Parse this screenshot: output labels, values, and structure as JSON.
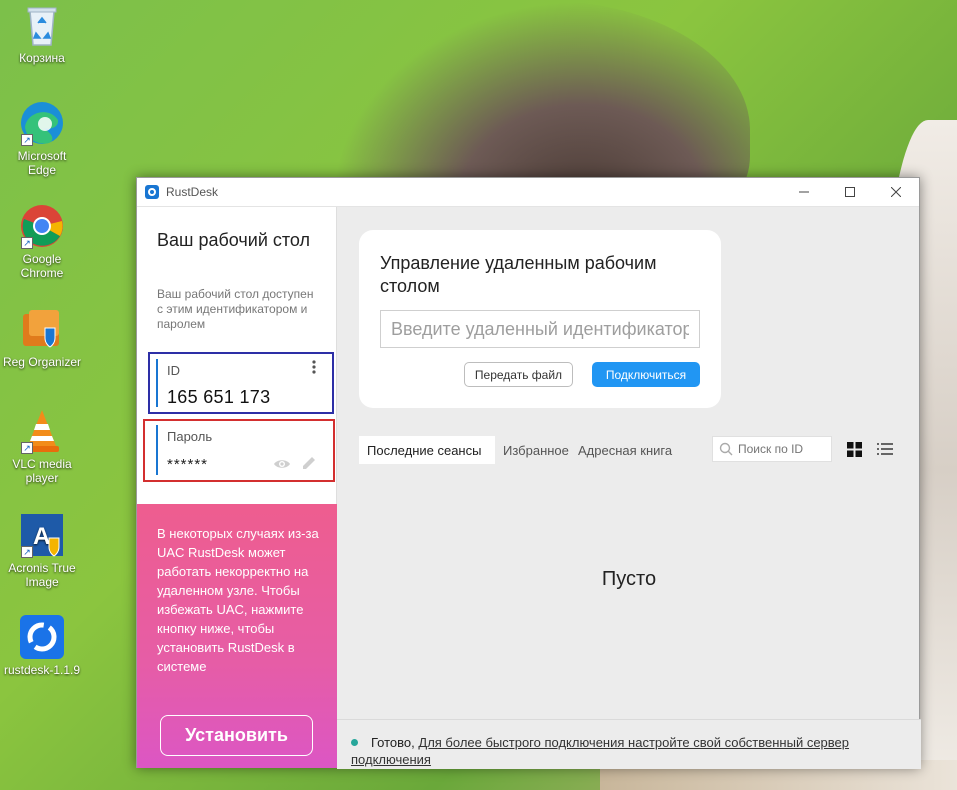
{
  "desktop": {
    "icons": [
      {
        "label": "Корзина"
      },
      {
        "label": "Microsoft Edge"
      },
      {
        "label": "Google Chrome"
      },
      {
        "label": "Reg Organizer"
      },
      {
        "label": "VLC media player"
      },
      {
        "label": "Acronis True Image"
      },
      {
        "label": "rustdesk-1.1.9"
      }
    ]
  },
  "window": {
    "title": "RustDesk",
    "controls": {
      "minimize": "—",
      "maximize": "☐",
      "close": "✕"
    }
  },
  "left": {
    "title": "Ваш рабочий стол",
    "description": "Ваш рабочий стол доступен с этим идентификатором и паролем",
    "id_label": "ID",
    "id_value": "165 651 173",
    "password_label": "Пароль",
    "password_value": "******",
    "install_text": "В некоторых случаях из-за UAC RustDesk может работать некорректно на удаленном узле. Чтобы избежать UAC, нажмите кнопку ниже, чтобы установить RustDesk в системе",
    "install_button": "Установить"
  },
  "main": {
    "card_title": "Управление удаленным рабочим столом",
    "remote_placeholder": "Введите удаленный идентификатор",
    "file_button": "Передать файл",
    "connect_button": "Подключиться",
    "tabs": [
      "Последние сеансы",
      "Избранное",
      "Адресная книга"
    ],
    "search_placeholder": "Поиск по ID",
    "empty_text": "Пусто"
  },
  "status": {
    "ready": "Готово,",
    "link": "Для более быстрого подключения настройте свой собственный сервер подключения"
  },
  "colors": {
    "accent": "#2196f3",
    "id_highlight": "#2d2fa6",
    "password_highlight": "#d32f2f",
    "status_ok": "#26a69a"
  }
}
